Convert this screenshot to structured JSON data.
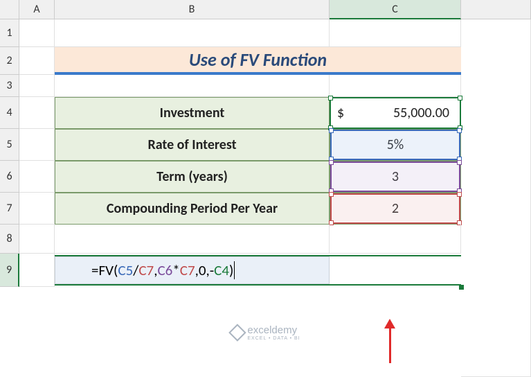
{
  "columns": {
    "A": "A",
    "B": "B",
    "C": "C"
  },
  "rows": {
    "r1": "1",
    "r2": "2",
    "r3": "3",
    "r4": "4",
    "r5": "5",
    "r6": "6",
    "r7": "7",
    "r8": "8",
    "r9": "9"
  },
  "title": "Use of FV Function",
  "labels": {
    "investment": "Investment",
    "rate": "Rate of Interest",
    "term": "Term (years)",
    "period": "Compounding Period Per Year"
  },
  "values": {
    "currency_symbol": "$",
    "investment": "55,000.00",
    "rate": "5%",
    "term": "3",
    "period": "2"
  },
  "formula": {
    "prefix": "=FV(",
    "p1": "C5",
    "op1": "/",
    "p2": "C7",
    "op2": ",",
    "p3": "C6",
    "op3": "*",
    "p4": "C7",
    "op4": ",0,-",
    "p5": "C4",
    "suffix": ")"
  },
  "watermark": {
    "name": "exceldemy",
    "tag": "EXCEL • DATA • BI"
  },
  "chart_data": {
    "type": "table",
    "title": "Use of FV Function",
    "rows": [
      {
        "label": "Investment",
        "value": 55000.0,
        "format": "currency"
      },
      {
        "label": "Rate of Interest",
        "value": 0.05,
        "format": "percent"
      },
      {
        "label": "Term (years)",
        "value": 3
      },
      {
        "label": "Compounding Period Per Year",
        "value": 2
      }
    ],
    "formula_cell": "=FV(C5/C7,C6*C7,0,-C4)",
    "cell_refs": {
      "C4": 55000,
      "C5": 0.05,
      "C6": 3,
      "C7": 2
    }
  }
}
